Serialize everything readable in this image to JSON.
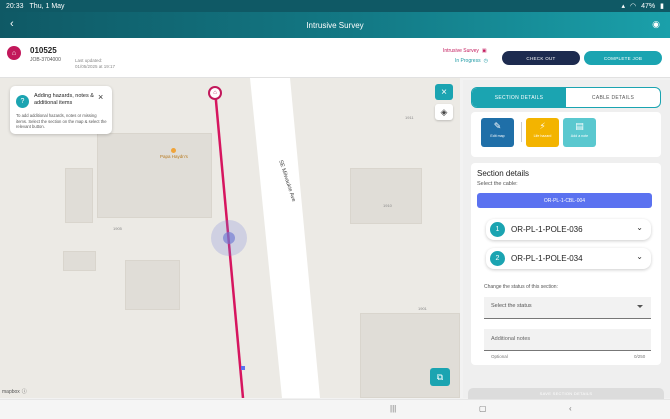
{
  "status_bar": {
    "time": "20:33",
    "date": "Thu, 1 May",
    "battery": "47%"
  },
  "app_bar": {
    "title": "Intrusive Survey",
    "back_icon": "chevron-left-icon",
    "wifi_icon": "wifi-icon"
  },
  "job": {
    "number": "010525",
    "job_id": "JOB-3704000",
    "last_updated_label": "Last updated:",
    "last_updated_value": "01/05/2025 at 19:17",
    "type": "Intrusive Survey",
    "status": "In Progress",
    "check_out_label": "CHECK OUT",
    "complete_label": "COMPLETE JOB"
  },
  "map": {
    "street": "SE Milwaukie Ave",
    "poi": "Papa Haydn's",
    "house_numbers": [
      "1905",
      "1911",
      "1910",
      "1901"
    ],
    "attribution": "mapbox",
    "tooltip": {
      "title": "Adding hazards, notes & additional items",
      "body": "To add additional hazards, notes or missing items. Select the section on the map & select the relevant button."
    }
  },
  "panel": {
    "tabs": [
      {
        "label": "SECTION DETAILS",
        "active": true
      },
      {
        "label": "CABLE DETAILS",
        "active": false
      }
    ],
    "tools": [
      {
        "label": "Edit map",
        "icon": "edit-map-icon"
      },
      {
        "label": "Life hazard",
        "icon": "hazard-icon"
      },
      {
        "label": "Add a note",
        "icon": "note-icon"
      }
    ],
    "details_title": "Section details",
    "select_cable_label": "Select the cable:",
    "cable": "OR-PL-1-CBL-004",
    "poles": [
      {
        "num": "1",
        "label": "OR-PL-1-POLE-036"
      },
      {
        "num": "2",
        "label": "OR-PL-1-POLE-034"
      }
    ],
    "change_status_label": "Change the status of this section:",
    "status_placeholder": "Select the status",
    "notes_placeholder": "Additional notes",
    "optional_label": "Optional",
    "counter": "0/250",
    "save_label": "SAVE SECTION DETAILS"
  },
  "colors": {
    "brand_teal": "#1ba4b1",
    "brand_dark": "#0f5965",
    "accent_pink": "#c2185b",
    "cable_blue": "#5b72f0"
  }
}
